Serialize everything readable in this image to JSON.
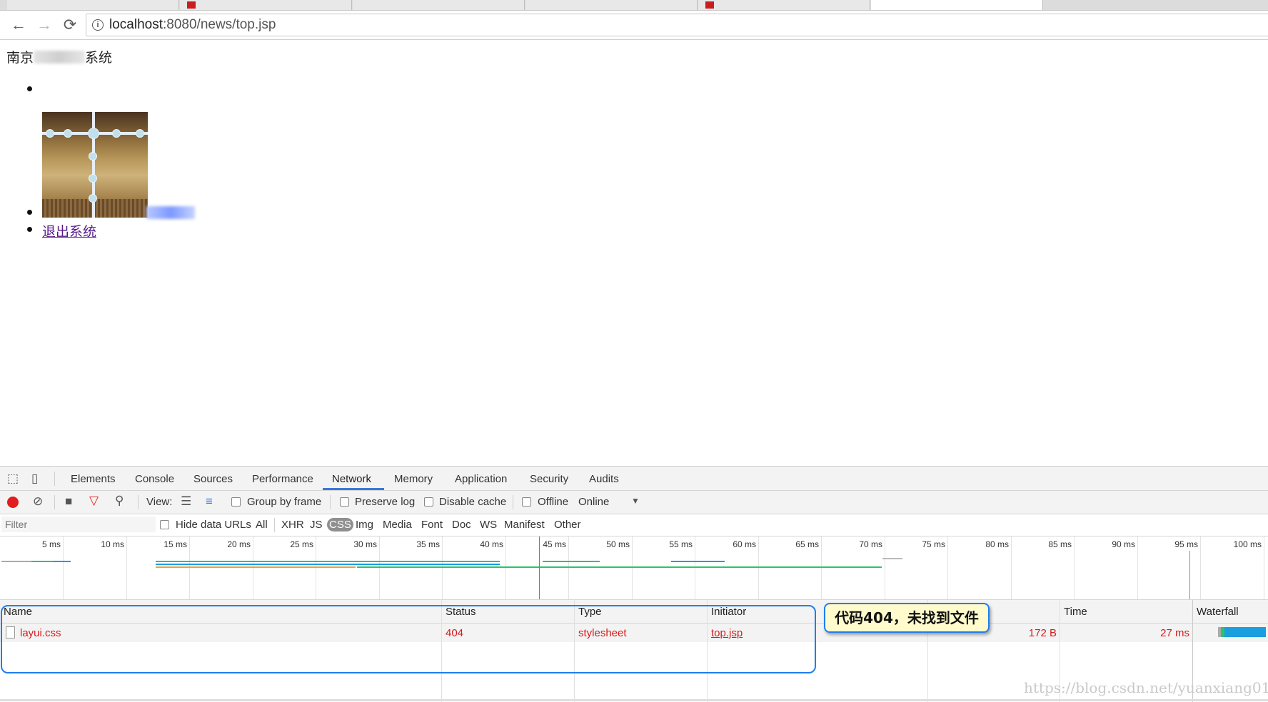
{
  "browser": {
    "url_host": "localhost",
    "url_path": ":8080/news/top.jsp",
    "back_icon": "arrow-left-icon",
    "forward_icon": "arrow-right-icon",
    "reload_icon": "reload-icon"
  },
  "page": {
    "title_prefix": "南京",
    "title_suffix": "系统",
    "logout_link": "退出系统"
  },
  "devtools": {
    "tabs": [
      "Elements",
      "Console",
      "Sources",
      "Performance",
      "Network",
      "Memory",
      "Application",
      "Security",
      "Audits"
    ],
    "active_tab": "Network",
    "toolbar": {
      "view_label": "View:",
      "group_by_frame": "Group by frame",
      "preserve_log": "Preserve log",
      "disable_cache": "Disable cache",
      "offline": "Offline",
      "throttle": "Online"
    },
    "filter": {
      "placeholder": "Filter",
      "hide_data_urls": "Hide data URLs",
      "types": [
        "All",
        "XHR",
        "JS",
        "CSS",
        "Img",
        "Media",
        "Font",
        "Doc",
        "WS",
        "Manifest",
        "Other"
      ],
      "active_type": "CSS"
    },
    "timeline_ticks": [
      "5 ms",
      "10 ms",
      "15 ms",
      "20 ms",
      "25 ms",
      "30 ms",
      "35 ms",
      "40 ms",
      "45 ms",
      "50 ms",
      "55 ms",
      "60 ms",
      "65 ms",
      "70 ms",
      "75 ms",
      "80 ms",
      "85 ms",
      "90 ms",
      "95 ms",
      "100 ms"
    ],
    "columns": {
      "name": "Name",
      "status": "Status",
      "type": "Type",
      "initiator": "Initiator",
      "time": "Time",
      "waterfall": "Waterfall"
    },
    "rows": [
      {
        "name": "layui.css",
        "status": "404",
        "type": "stylesheet",
        "initiator": "top.jsp",
        "size": "172 B",
        "time": "27 ms"
      }
    ]
  },
  "annotation": {
    "callout": "代码404，未找到文件"
  },
  "watermark": "https://blog.csdn.net/yuanxiang01",
  "colors": {
    "accent": "#1e7ef0",
    "error": "#d61a1a",
    "active_tab_underline": "#3879d9"
  }
}
